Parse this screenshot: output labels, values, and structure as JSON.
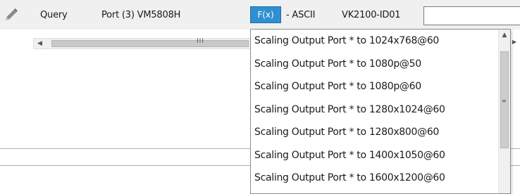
{
  "row": {
    "edit_icon": "pencil-icon",
    "query_label": "Query",
    "port_label": "Port (3) VM5808H",
    "function_button_label": "F(x)",
    "protocol_label": "- ASCII",
    "device_label": "VK2100-ID01",
    "command_value": ""
  },
  "horizontal_scrollbar": {
    "left_arrow": "◀",
    "grip": "III"
  },
  "dropdown": {
    "options": [
      "Scaling Output Port * to 1024x768@60",
      "Scaling Output Port * to 1080p@50",
      "Scaling Output Port * to 1080p@60",
      "Scaling Output Port * to 1280x1024@60",
      "Scaling Output Port * to 1280x800@60",
      "Scaling Output Port * to 1400x1050@60",
      "Scaling Output Port * to 1600x1200@60"
    ],
    "scroll_up_arrow": "▲",
    "scroll_grip": "≡"
  },
  "colors": {
    "fx_button": "#2f8fd1",
    "row_background": "#f0f0f0"
  }
}
